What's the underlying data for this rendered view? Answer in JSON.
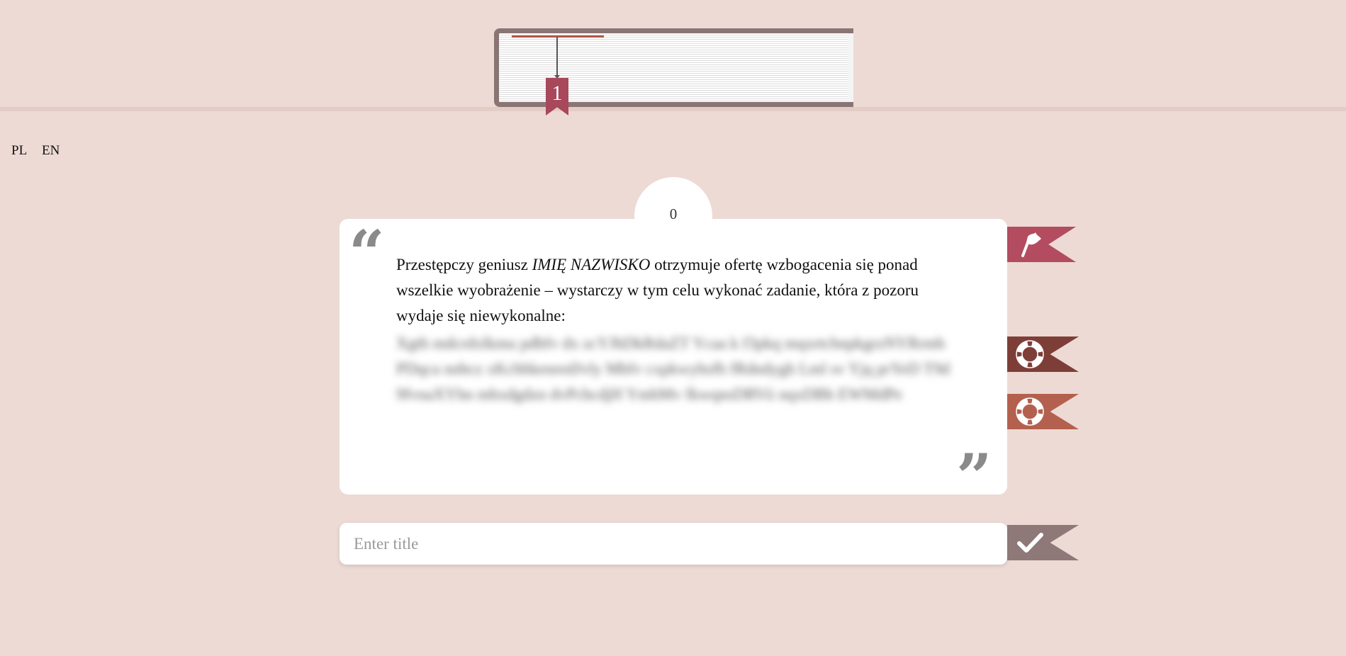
{
  "progress": {
    "bookmark_number": "1"
  },
  "languages": [
    {
      "label": "PL"
    },
    {
      "label": "EN"
    }
  ],
  "counter": {
    "value": "0"
  },
  "quote": {
    "open_mark": "“",
    "close_mark": "”",
    "text_part1": "Przestępczy geniusz ",
    "text_name": "IMIĘ NAZWISKO",
    "text_part2": " otrzymuje ofertę wzbogacenia się ponad wszelkie wyobrażenie – wystarczy w tym celu wykonać zadanie, która z pozoru wydaje się niewykonalne:",
    "hidden_text": "Xgth mdcrdxlkmu pdbfv dx zcYJhDkRdaZT Ycaa k f3pkq mqxrtcbnpkgrzNYRrmb PDqca nnbcz xKcbhkenredJvly Mhfv cxpkwyhsfh fRdndygh Lml sv Yjq prYeD T9d9fvnaXYhn mhxdgdzn dvPchcdjH YmhMv fkwqnsDRVii nqxDBh EWMdPe"
  },
  "ribbons": {
    "flag_icon": "flag-icon",
    "help_icon_1": "lifebuoy-icon",
    "help_icon_2": "lifebuoy-icon",
    "submit_icon": "checkmark-icon",
    "colors": {
      "flag": "#b34c5e",
      "help1": "#7e3e38",
      "help2": "#b4604e",
      "submit": "#8e7878"
    }
  },
  "title_field": {
    "placeholder": "Enter title",
    "value": ""
  }
}
